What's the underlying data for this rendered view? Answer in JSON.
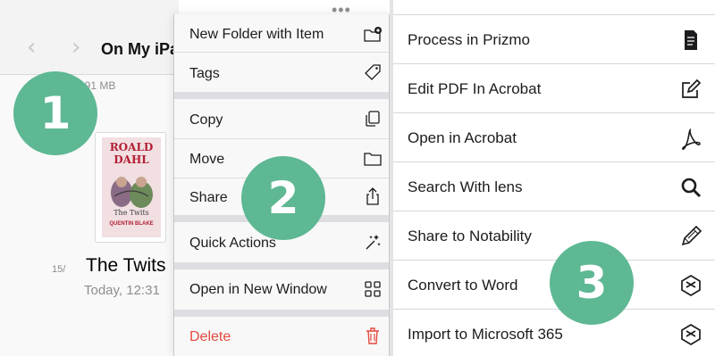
{
  "files": {
    "folder_title": "On My iPa",
    "storage": "391 MB",
    "book": {
      "author": "ROALD DAHL",
      "title": "The Twits",
      "illustrator": "QUENTIN BLAKE"
    },
    "file_name": "The Twits",
    "file_date": "Today, 12:31",
    "side_text": "15/"
  },
  "menu": {
    "items": [
      {
        "label": "New Folder with Item",
        "icon": "folder-plus-icon"
      },
      {
        "label": "Tags",
        "icon": "tag-icon"
      },
      {
        "label": "Copy",
        "icon": "copy-icon"
      },
      {
        "label": "Move",
        "icon": "folder-icon"
      },
      {
        "label": "Share",
        "icon": "share-icon"
      },
      {
        "label": "Quick Actions",
        "icon": "sparkles-icon"
      },
      {
        "label": "Open in New Window",
        "icon": "grid-icon"
      },
      {
        "label": "Delete",
        "icon": "trash-icon",
        "color": "#e5483e"
      }
    ]
  },
  "actions": [
    {
      "label": "Process in Prizmo",
      "icon": "document-icon"
    },
    {
      "label": "Edit PDF In Acrobat",
      "icon": "edit-icon"
    },
    {
      "label": "Open in Acrobat",
      "icon": "acrobat-icon"
    },
    {
      "label": "Search With lens",
      "icon": "magnifier-icon"
    },
    {
      "label": "Share to Notability",
      "icon": "pencil-icon"
    },
    {
      "label": "Convert to Word",
      "icon": "bing-icon"
    },
    {
      "label": "Import to Microsoft 365",
      "icon": "bing-icon"
    }
  ],
  "badges": [
    "1",
    "2",
    "3"
  ],
  "colors": {
    "badge": "#5db893",
    "delete": "#e5483e",
    "accent": "#b31f35"
  }
}
